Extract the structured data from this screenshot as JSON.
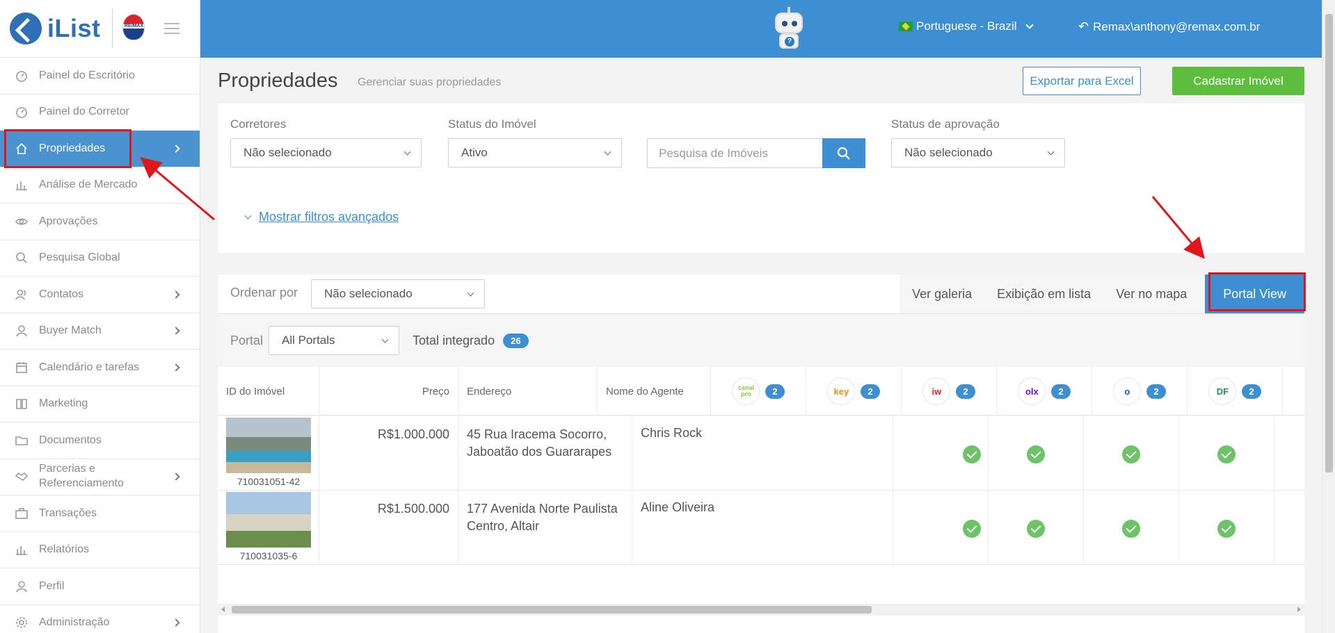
{
  "app": {
    "name": "iList",
    "brand_badge": "RE/MAX"
  },
  "topbar": {
    "language": "Portuguese - Brazil",
    "user": "Remax\\anthony@remax.com.br"
  },
  "sidebar": {
    "items": [
      {
        "label": "Painel do Escritório",
        "icon": "dashboard-icon",
        "has_submenu": false
      },
      {
        "label": "Painel do Corretor",
        "icon": "dashboard-icon",
        "has_submenu": false
      },
      {
        "label": "Propriedades",
        "icon": "home-icon",
        "has_submenu": true,
        "active": true
      },
      {
        "label": "Análise de Mercado",
        "icon": "bar-chart-icon",
        "has_submenu": false
      },
      {
        "label": "Aprovações",
        "icon": "eye-icon",
        "has_submenu": false
      },
      {
        "label": "Pesquisa Global",
        "icon": "search-icon",
        "has_submenu": false
      },
      {
        "label": "Contatos",
        "icon": "contacts-icon",
        "has_submenu": true
      },
      {
        "label": "Buyer Match",
        "icon": "user-icon",
        "has_submenu": true
      },
      {
        "label": "Calendário e tarefas",
        "icon": "calendar-icon",
        "has_submenu": true
      },
      {
        "label": "Marketing",
        "icon": "book-icon",
        "has_submenu": false
      },
      {
        "label": "Documentos",
        "icon": "folder-icon",
        "has_submenu": false
      },
      {
        "label": "Parcerias e Referenciamento",
        "icon": "handshake-icon",
        "has_submenu": true
      },
      {
        "label": "Transações",
        "icon": "briefcase-icon",
        "has_submenu": false
      },
      {
        "label": "Relatórios",
        "icon": "bar-chart-icon",
        "has_submenu": false
      },
      {
        "label": "Perfil",
        "icon": "user-icon",
        "has_submenu": false
      },
      {
        "label": "Administração",
        "icon": "gear-icon",
        "has_submenu": true
      }
    ]
  },
  "page": {
    "title": "Propriedades",
    "subtitle": "Gerenciar suas propriedades",
    "export_label": "Exportar para Excel",
    "new_label": "Cadastrar Imóvel"
  },
  "filters": {
    "brokers_label": "Corretores",
    "brokers_value": "Não selecionado",
    "status_label": "Status do Imóvel",
    "status_value": "Ativo",
    "search_placeholder": "Pesquisa de Imóveis",
    "approval_label": "Status de aprovação",
    "approval_value": "Não selecionado",
    "advanced_label": "Mostrar filtros avançados"
  },
  "list": {
    "sort_label": "Ordenar por",
    "sort_value": "Não selecionado",
    "views": [
      "Ver galeria",
      "Exibição em lista",
      "Ver no mapa",
      "Portal View"
    ],
    "active_view": "Portal View",
    "portal_label": "Portal",
    "portal_value": "All Portals",
    "total_label": "Total integrado",
    "total_count": "26",
    "columns": {
      "id": "ID do Imóvel",
      "price": "Preço",
      "address": "Endereço",
      "agent": "Nome do Agente"
    },
    "portals": [
      {
        "name": "Canal Pro",
        "logo_text": "canal pro",
        "count": "2",
        "color": "#8dc63f"
      },
      {
        "name": "Chaves na Mão",
        "logo_text": "key",
        "count": "2",
        "color": "#f28c1a"
      },
      {
        "name": "ImovelWeb",
        "logo_text": "iw",
        "count": "2",
        "color": "#e5202b"
      },
      {
        "name": "OLX",
        "logo_text": "olx",
        "count": "2",
        "color": "#6e0ad6"
      },
      {
        "name": "Imovelweb O",
        "logo_text": "o",
        "count": "2",
        "color": "#1a4fd6"
      },
      {
        "name": "DF Imóveis",
        "logo_text": "DF",
        "count": "2",
        "color": "#2a8f5f"
      }
    ],
    "rows": [
      {
        "id": "710031051-42",
        "price": "R$1.000.000",
        "address": "45 Rua Iracema Socorro, Jaboatão dos Guararapes",
        "agent": "Chris Rock",
        "checks": [
          false,
          false,
          true,
          true,
          true,
          true
        ]
      },
      {
        "id": "710031035-6",
        "price": "R$1.500.000",
        "address": "177 Avenida Norte Paulista Centro, Altair",
        "agent": "Aline Oliveira",
        "checks": [
          false,
          false,
          true,
          true,
          true,
          true
        ]
      }
    ]
  },
  "colors": {
    "primary": "#3d8fd1",
    "success": "#5dbe3d",
    "annotation": "#e0161c"
  }
}
